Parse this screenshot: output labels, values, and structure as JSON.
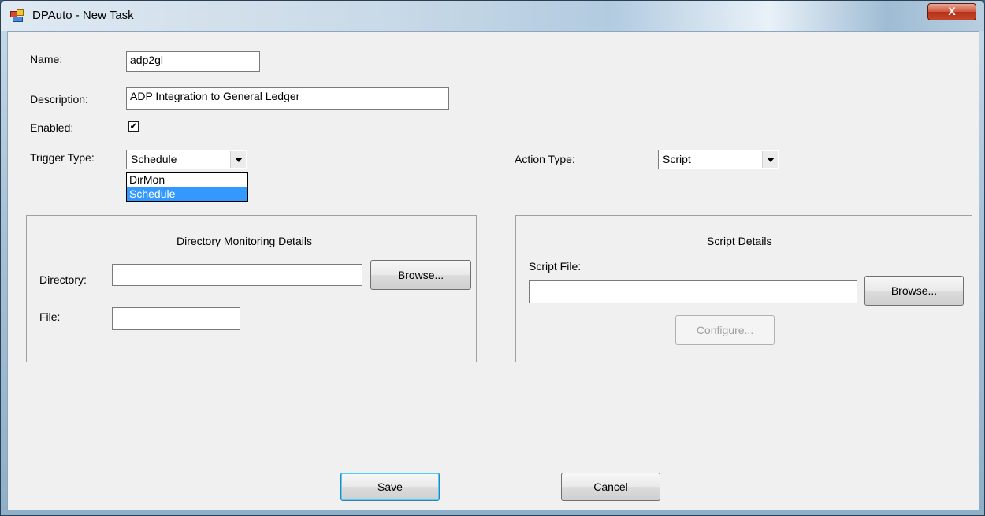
{
  "window": {
    "title": "DPAuto - New Task",
    "close_label": "X"
  },
  "form": {
    "name_label": "Name:",
    "name_value": "adp2gl",
    "description_label": "Description:",
    "description_value": "ADP Integration to General Ledger",
    "enabled_label": "Enabled:",
    "enabled_checked": true,
    "enabled_mark": "✔",
    "trigger_type_label": "Trigger Type:",
    "trigger_type_value": "Schedule",
    "trigger_type_options": [
      "DirMon",
      "Schedule"
    ],
    "action_type_label": "Action Type:",
    "action_type_value": "Script"
  },
  "directory_group": {
    "title": "Directory Monitoring Details",
    "directory_label": "Directory:",
    "directory_value": "",
    "browse_label": "Browse...",
    "file_label": "File:",
    "file_value": ""
  },
  "script_group": {
    "title": "Script Details",
    "script_file_label": "Script File:",
    "script_file_value": "",
    "browse_label": "Browse...",
    "configure_label": "Configure..."
  },
  "footer": {
    "save_label": "Save",
    "cancel_label": "Cancel"
  },
  "colors": {
    "selection": "#3399ff",
    "client_bg": "#f0f0f0",
    "close_red": "#c7452a"
  }
}
